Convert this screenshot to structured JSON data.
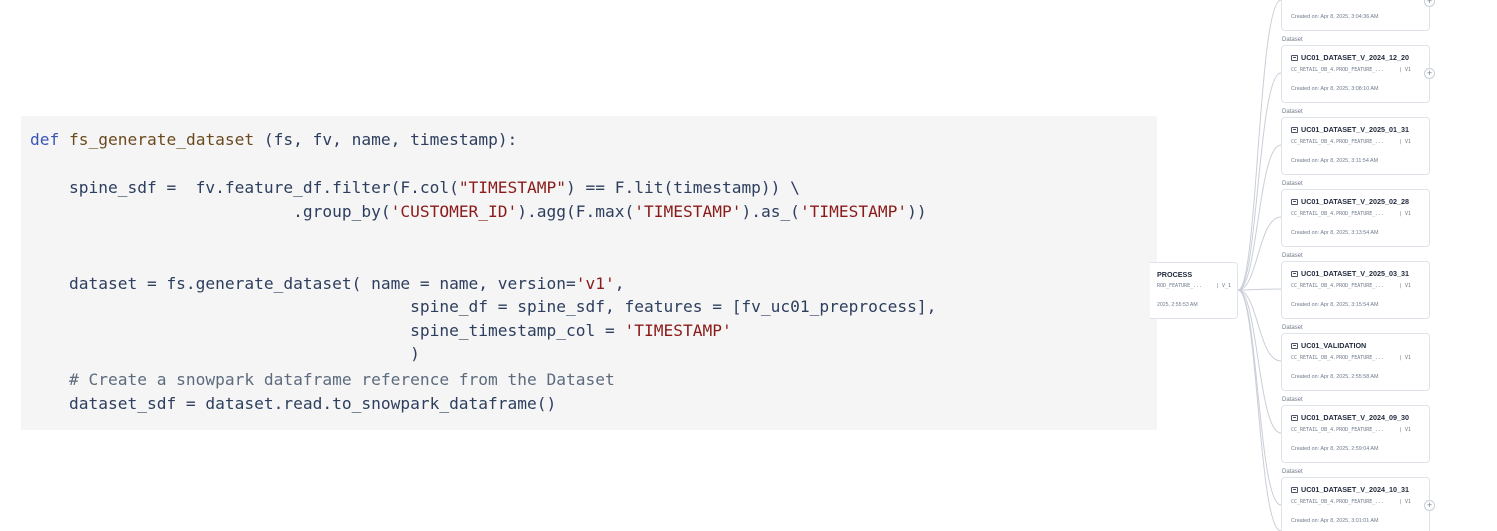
{
  "code": {
    "line1": {
      "kw": "def",
      "fn": "fs_generate_dataset",
      "rest": " (fs, fv, name, timestamp):"
    },
    "line2": {
      "a": "    spine_sdf =  fv.feature_df.filter(F.col(",
      "s1": "\"TIMESTAMP\"",
      "b": ") == F.lit(timestamp)) \\"
    },
    "line3": {
      "a": "                           .group_by(",
      "s1": "'CUSTOMER_ID'",
      "b": ").agg(F.max(",
      "s2": "'TIMESTAMP'",
      "c": ").as_(",
      "s3": "'TIMESTAMP'",
      "d": "))"
    },
    "line4": {
      "a": "    dataset = fs.generate_dataset( name = name, version=",
      "s1": "'v1'",
      "b": ","
    },
    "line5": {
      "a": "                                       spine_df = spine_sdf, features = [fv_uc01_preprocess],"
    },
    "line6": {
      "a": "                                       spine_timestamp_col = ",
      "s1": "'TIMESTAMP'"
    },
    "line7": {
      "a": "                                       )"
    },
    "line8": {
      "comment": "    # Create a snowpark dataframe reference from the Dataset"
    },
    "line9": {
      "a": "    dataset_sdf = dataset.read.to_snowpark_dataframe()"
    }
  },
  "source_node": {
    "title": "PROCESS",
    "sub": "ROD_FEATURE_...",
    "version": "| V_1",
    "created": "2025, 2:55:53 AM"
  },
  "datasets": [
    {
      "label": "Dataset",
      "name": "UC01_DATASET_V_2024_12_20",
      "sub": "CC_RETAIL_DB_4.PROD_FEATURE_...",
      "version": "| V1",
      "created": "Created on: Apr 8, 2025, 3:08:10 AM"
    },
    {
      "label": "Dataset",
      "name": "UC01_DATASET_V_2025_01_31",
      "sub": "CC_RETAIL_DB_4.PROD_FEATURE_...",
      "version": "| V1",
      "created": "Created on: Apr 8, 2025, 3:11:54 AM"
    },
    {
      "label": "Dataset",
      "name": "UC01_DATASET_V_2025_02_28",
      "sub": "CC_RETAIL_DB_4.PROD_FEATURE_...",
      "version": "| V1",
      "created": "Created on: Apr 8, 2025, 3:13:54 AM"
    },
    {
      "label": "Dataset",
      "name": "UC01_DATASET_V_2025_03_31",
      "sub": "CC_RETAIL_DB_4.PROD_FEATURE_...",
      "version": "| V1",
      "created": "Created on: Apr 8, 2025, 3:15:54 AM"
    },
    {
      "label": "Dataset",
      "name": "UC01_VALIDATION",
      "sub": "CC_RETAIL_DB_4.PROD_FEATURE_...",
      "version": "| V1",
      "created": "Created on: Apr 8, 2025, 2:55:58 AM"
    },
    {
      "label": "Dataset",
      "name": "UC01_DATASET_V_2024_09_30",
      "sub": "CC_RETAIL_DB_4.PROD_FEATURE_...",
      "version": "| V1",
      "created": "Created on: Apr 8, 2025, 2:59:04 AM"
    },
    {
      "label": "Dataset",
      "name": "UC01_DATASET_V_2024_10_31",
      "sub": "CC_RETAIL_DB_4.PROD_FEATURE_...",
      "version": "| V1",
      "created": "Created on: Apr 8, 2025, 3:01:01 AM"
    }
  ],
  "top_partial": {
    "created": "Created on: Apr 8, 2025, 3:04:36 AM",
    "label": "Dataset"
  },
  "plus_symbol": "+"
}
